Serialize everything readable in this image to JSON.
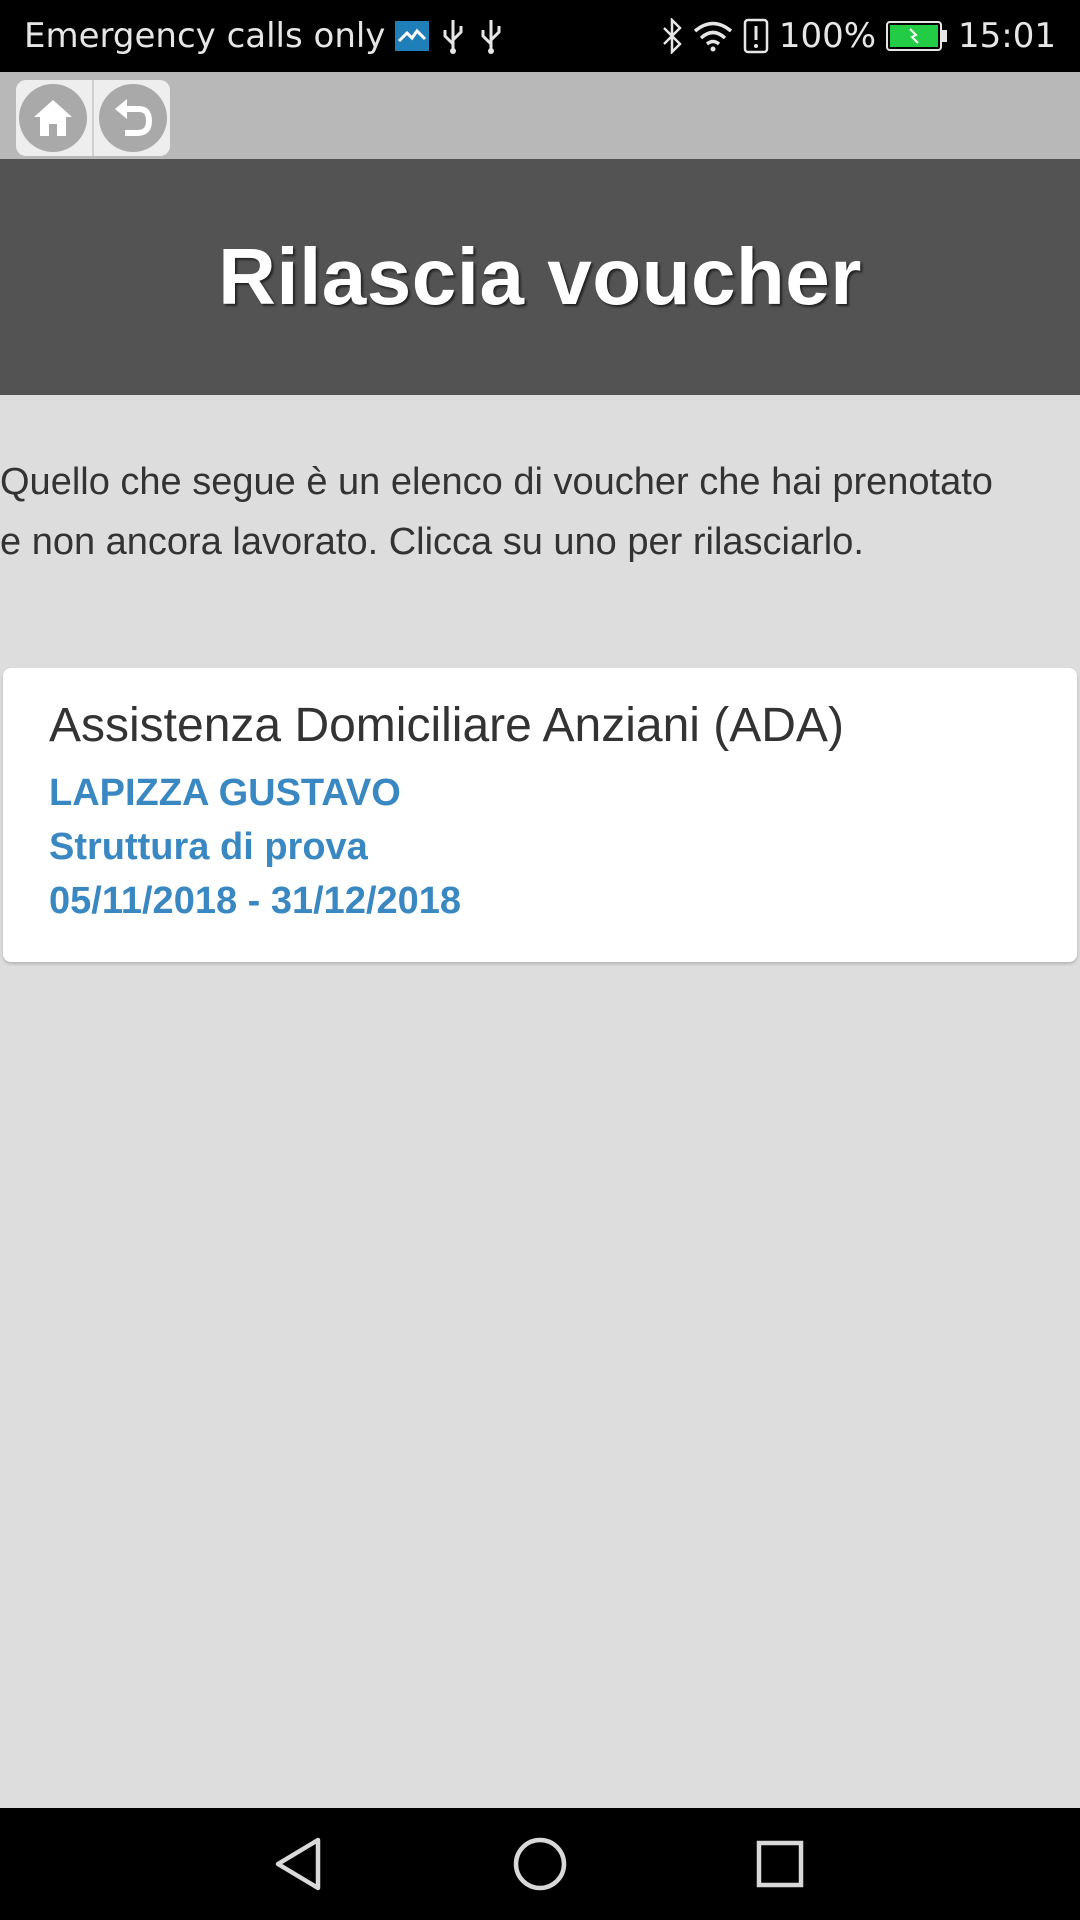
{
  "status_bar": {
    "carrier_text": "Emergency calls only",
    "battery_percent": "100%",
    "time": "15:01",
    "icons": [
      "app-notification-icon",
      "usb-icon",
      "usb-icon",
      "bluetooth-icon",
      "wifi-icon",
      "alert-icon",
      "battery-icon"
    ]
  },
  "toolbar": {
    "home_icon": "home-icon",
    "back_icon": "undo-icon"
  },
  "header": {
    "title": "Rilascia voucher"
  },
  "intro": {
    "text": "Quello che segue è un elenco di voucher che hai prenotato e non ancora lavorato. Clicca su uno per rilasciarlo."
  },
  "vouchers": [
    {
      "title": "Assistenza Domiciliare Anziani (ADA)",
      "name": "LAPIZZA GUSTAVO",
      "structure": "Struttura di prova",
      "period": "05/11/2018 - 31/12/2018"
    }
  ],
  "nav_bar": {
    "back_icon": "nav-back-icon",
    "home_icon": "nav-home-icon",
    "recents_icon": "nav-recents-icon"
  },
  "colors": {
    "status_bar_bg": "#000000",
    "toolbar_bg": "#b8b8b8",
    "header_bg": "#535353",
    "page_bg": "#dddddd",
    "card_bg": "#ffffff",
    "accent_blue": "#3a88c2",
    "battery_green": "#22cc44"
  }
}
